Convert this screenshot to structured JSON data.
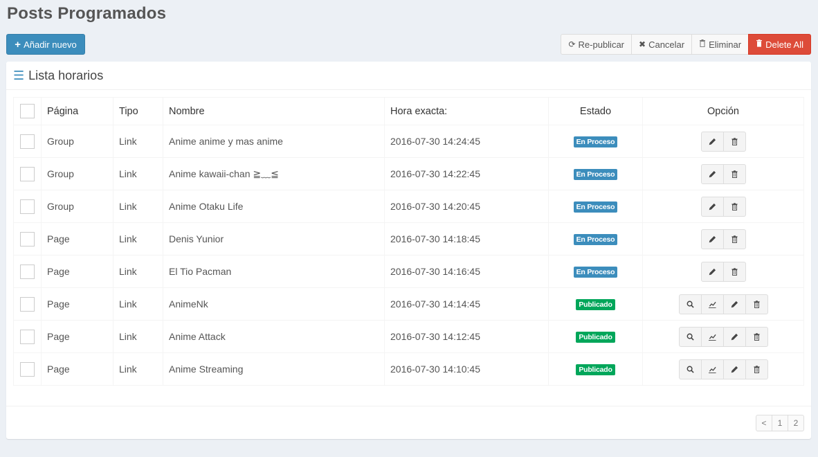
{
  "page": {
    "title": "Posts Programados",
    "add_button": "Añadir nuevo"
  },
  "toolbar": {
    "republish": "Re-publicar",
    "cancel": "Cancelar",
    "delete": "Eliminar",
    "delete_all": "Delete All"
  },
  "box": {
    "title": "Lista horarios"
  },
  "table": {
    "headers": {
      "pagina": "Página",
      "tipo": "Tipo",
      "nombre": "Nombre",
      "hora": "Hora exacta:",
      "estado": "Estado",
      "opcion": "Opción"
    },
    "rows": [
      {
        "pagina": "Group",
        "tipo": "Link",
        "nombre": "Anime anime y mas anime",
        "hora": "2016-07-30 14:24:45",
        "estado": "En Proceso",
        "status": "proceso"
      },
      {
        "pagina": "Group",
        "tipo": "Link",
        "nombre": "Anime kawaii-chan ≧﹏≦",
        "hora": "2016-07-30 14:22:45",
        "estado": "En Proceso",
        "status": "proceso"
      },
      {
        "pagina": "Group",
        "tipo": "Link",
        "nombre": "Anime Otaku Life",
        "hora": "2016-07-30 14:20:45",
        "estado": "En Proceso",
        "status": "proceso"
      },
      {
        "pagina": "Page",
        "tipo": "Link",
        "nombre": "Denis Yunior",
        "hora": "2016-07-30 14:18:45",
        "estado": "En Proceso",
        "status": "proceso"
      },
      {
        "pagina": "Page",
        "tipo": "Link",
        "nombre": "El Tio Pacman",
        "hora": "2016-07-30 14:16:45",
        "estado": "En Proceso",
        "status": "proceso"
      },
      {
        "pagina": "Page",
        "tipo": "Link",
        "nombre": "AnimeNk",
        "hora": "2016-07-30 14:14:45",
        "estado": "Publicado",
        "status": "publicado"
      },
      {
        "pagina": "Page",
        "tipo": "Link",
        "nombre": "Anime Attack",
        "hora": "2016-07-30 14:12:45",
        "estado": "Publicado",
        "status": "publicado"
      },
      {
        "pagina": "Page",
        "tipo": "Link",
        "nombre": "Anime Streaming",
        "hora": "2016-07-30 14:10:45",
        "estado": "Publicado",
        "status": "publicado"
      }
    ]
  },
  "pagination": {
    "prev": "<",
    "pages": [
      "1",
      "2"
    ]
  },
  "colors": {
    "primary": "#3c8dbc",
    "danger": "#dd4b39",
    "success": "#00a65a"
  }
}
